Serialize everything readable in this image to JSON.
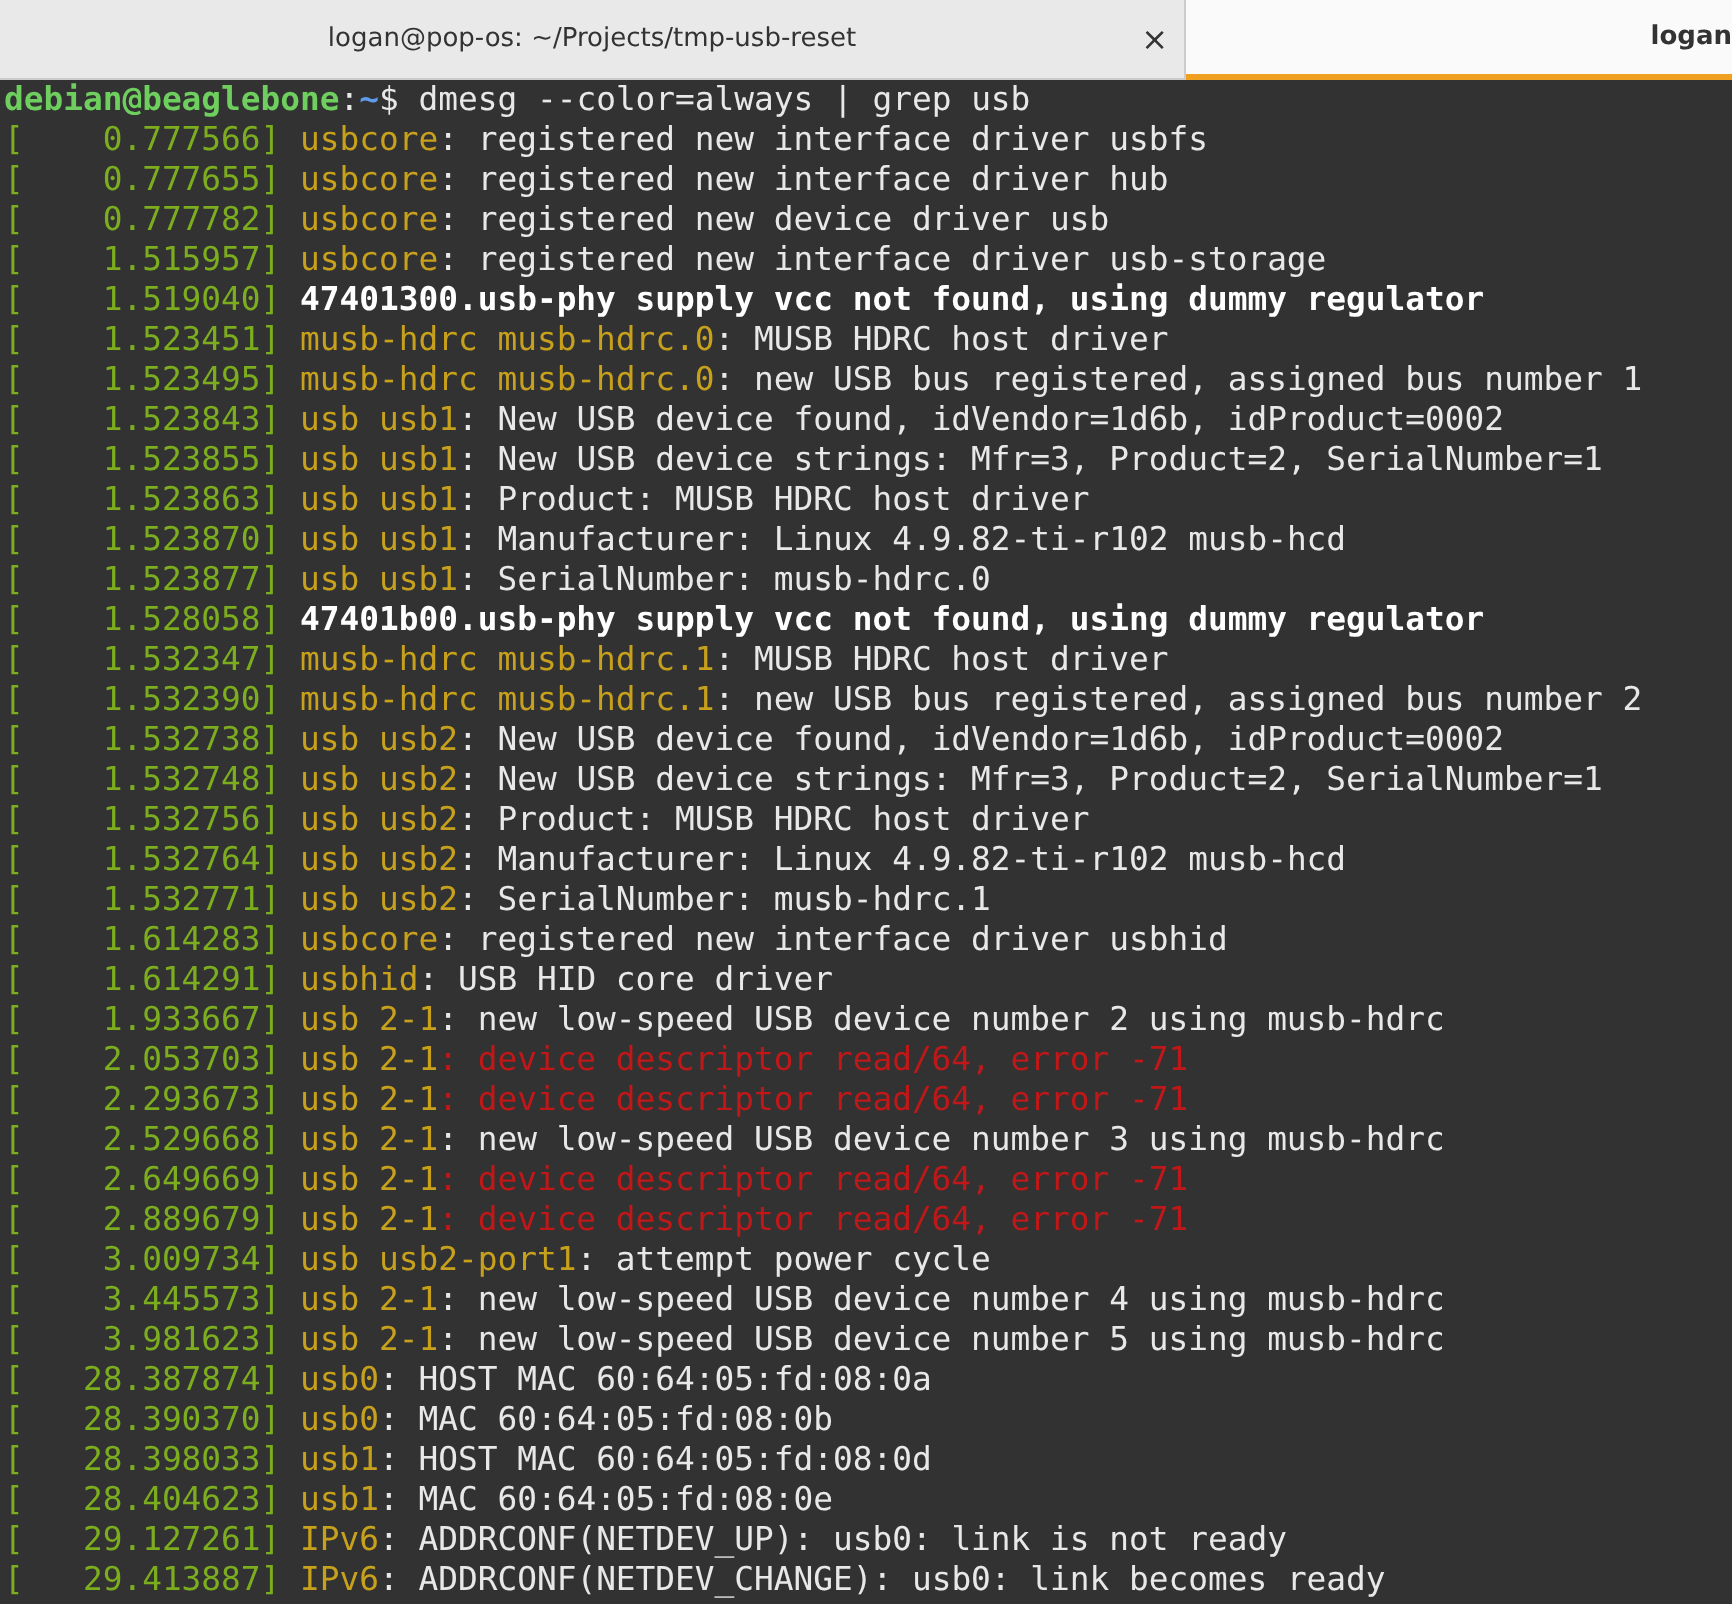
{
  "tabs": [
    {
      "label": "logan@pop-os: ~/Projects/tmp-usb-reset",
      "close": "×",
      "selected": false
    },
    {
      "label": "logan",
      "selected": true
    }
  ],
  "prompt": {
    "user_host": "debian@beaglebone",
    "separator": ":",
    "path": "~",
    "symbol": "$",
    "command": " dmesg --color=always | grep usb"
  },
  "log": [
    {
      "time": "[    0.777566]",
      "source": "usbcore",
      "message": ": registered new interface driver usbfs",
      "kind": "plain"
    },
    {
      "time": "[    0.777655]",
      "source": "usbcore",
      "message": ": registered new interface driver hub",
      "kind": "plain"
    },
    {
      "time": "[    0.777782]",
      "source": "usbcore",
      "message": ": registered new device driver usb",
      "kind": "plain"
    },
    {
      "time": "[    1.515957]",
      "source": "usbcore",
      "message": ": registered new interface driver usb-storage",
      "kind": "plain"
    },
    {
      "time": "[    1.519040]",
      "message": "47401300.usb-phy supply vcc not found, using dummy regulator",
      "kind": "bold"
    },
    {
      "time": "[    1.523451]",
      "source": "musb-hdrc musb-hdrc.0",
      "message": ": MUSB HDRC host driver",
      "kind": "plain"
    },
    {
      "time": "[    1.523495]",
      "source": "musb-hdrc musb-hdrc.0",
      "message": ": new USB bus registered, assigned bus number 1",
      "kind": "plain"
    },
    {
      "time": "[    1.523843]",
      "source": "usb usb1",
      "message": ": New USB device found, idVendor=1d6b, idProduct=0002",
      "kind": "plain"
    },
    {
      "time": "[    1.523855]",
      "source": "usb usb1",
      "message": ": New USB device strings: Mfr=3, Product=2, SerialNumber=1",
      "kind": "plain"
    },
    {
      "time": "[    1.523863]",
      "source": "usb usb1",
      "message": ": Product: MUSB HDRC host driver",
      "kind": "plain"
    },
    {
      "time": "[    1.523870]",
      "source": "usb usb1",
      "message": ": Manufacturer: Linux 4.9.82-ti-r102 musb-hcd",
      "kind": "plain"
    },
    {
      "time": "[    1.523877]",
      "source": "usb usb1",
      "message": ": SerialNumber: musb-hdrc.0",
      "kind": "plain"
    },
    {
      "time": "[    1.528058]",
      "message": "47401b00.usb-phy supply vcc not found, using dummy regulator",
      "kind": "bold"
    },
    {
      "time": "[    1.532347]",
      "source": "musb-hdrc musb-hdrc.1",
      "message": ": MUSB HDRC host driver",
      "kind": "plain"
    },
    {
      "time": "[    1.532390]",
      "source": "musb-hdrc musb-hdrc.1",
      "message": ": new USB bus registered, assigned bus number 2",
      "kind": "plain"
    },
    {
      "time": "[    1.532738]",
      "source": "usb usb2",
      "message": ": New USB device found, idVendor=1d6b, idProduct=0002",
      "kind": "plain"
    },
    {
      "time": "[    1.532748]",
      "source": "usb usb2",
      "message": ": New USB device strings: Mfr=3, Product=2, SerialNumber=1",
      "kind": "plain"
    },
    {
      "time": "[    1.532756]",
      "source": "usb usb2",
      "message": ": Product: MUSB HDRC host driver",
      "kind": "plain"
    },
    {
      "time": "[    1.532764]",
      "source": "usb usb2",
      "message": ": Manufacturer: Linux 4.9.82-ti-r102 musb-hcd",
      "kind": "plain"
    },
    {
      "time": "[    1.532771]",
      "source": "usb usb2",
      "message": ": SerialNumber: musb-hdrc.1",
      "kind": "plain"
    },
    {
      "time": "[    1.614283]",
      "source": "usbcore",
      "message": ": registered new interface driver usbhid",
      "kind": "plain"
    },
    {
      "time": "[    1.614291]",
      "source": "usbhid",
      "message": ": USB HID core driver",
      "kind": "plain"
    },
    {
      "time": "[    1.933667]",
      "source": "usb 2-1",
      "message": ": new low-speed USB device number 2 using musb-hdrc",
      "kind": "plain"
    },
    {
      "time": "[    2.053703]",
      "source": "usb 2-1",
      "message": ": device descriptor read/64, error -71",
      "kind": "error"
    },
    {
      "time": "[    2.293673]",
      "source": "usb 2-1",
      "message": ": device descriptor read/64, error -71",
      "kind": "error"
    },
    {
      "time": "[    2.529668]",
      "source": "usb 2-1",
      "message": ": new low-speed USB device number 3 using musb-hdrc",
      "kind": "plain"
    },
    {
      "time": "[    2.649669]",
      "source": "usb 2-1",
      "message": ": device descriptor read/64, error -71",
      "kind": "error"
    },
    {
      "time": "[    2.889679]",
      "source": "usb 2-1",
      "message": ": device descriptor read/64, error -71",
      "kind": "error"
    },
    {
      "time": "[    3.009734]",
      "source": "usb usb2-port1",
      "message": ": attempt power cycle",
      "kind": "plain"
    },
    {
      "time": "[    3.445573]",
      "source": "usb 2-1",
      "message": ": new low-speed USB device number 4 using musb-hdrc",
      "kind": "plain"
    },
    {
      "time": "[    3.981623]",
      "source": "usb 2-1",
      "message": ": new low-speed USB device number 5 using musb-hdrc",
      "kind": "plain"
    },
    {
      "time": "[   28.387874]",
      "source": "usb0",
      "message": ": HOST MAC 60:64:05:fd:08:0a",
      "kind": "plain"
    },
    {
      "time": "[   28.390370]",
      "source": "usb0",
      "message": ": MAC 60:64:05:fd:08:0b",
      "kind": "plain"
    },
    {
      "time": "[   28.398033]",
      "source": "usb1",
      "message": ": HOST MAC 60:64:05:fd:08:0d",
      "kind": "plain"
    },
    {
      "time": "[   28.404623]",
      "source": "usb1",
      "message": ": MAC 60:64:05:fd:08:0e",
      "kind": "plain"
    },
    {
      "time": "[   29.127261]",
      "source": "IPv6",
      "message": ": ADDRCONF(NETDEV_UP): usb0: link is not ready",
      "kind": "plain"
    },
    {
      "time": "[   29.413887]",
      "source": "IPv6",
      "message": ": ADDRCONF(NETDEV_CHANGE): usb0: link becomes ready",
      "kind": "plain"
    }
  ]
}
